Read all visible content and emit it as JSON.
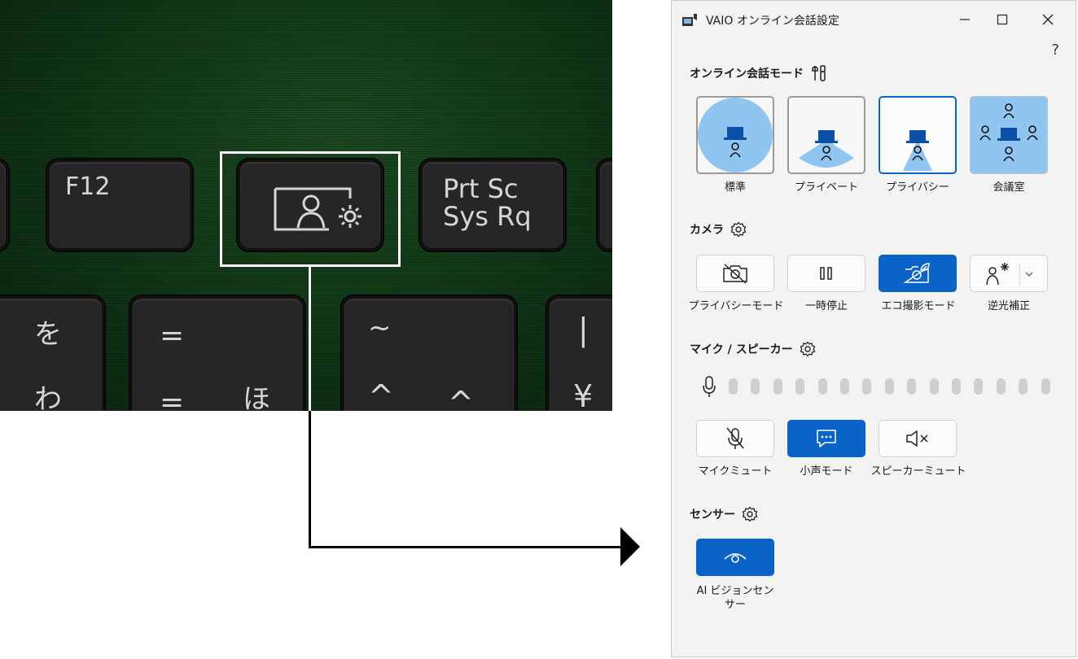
{
  "keyboard": {
    "keys": {
      "f12": "F12",
      "prtsc": "Prt Sc\nSys Rq",
      "wo": "を",
      "wa": "わ",
      "equals": "=",
      "minus": "=",
      "ho": "ほ",
      "tilde": "~",
      "caret": "^",
      "hat": "^",
      "pipe": "|",
      "yen": "¥"
    }
  },
  "window": {
    "title": "VAIO オンライン会話設定",
    "help": "?",
    "controls": {
      "minimize": "—",
      "maximize": "☐",
      "close": "✕"
    }
  },
  "sections": {
    "mode": {
      "title": "オンライン会話モード",
      "items": [
        {
          "label": "標準",
          "state": "outlined-gray"
        },
        {
          "label": "プライベート",
          "state": "outlined-gray"
        },
        {
          "label": "プライバシー",
          "state": "selected"
        },
        {
          "label": "会議室",
          "state": "filled-light"
        }
      ]
    },
    "camera": {
      "title": "カメラ",
      "items": [
        {
          "label": "プライバシーモード",
          "icon": "camera-off-icon",
          "active": false
        },
        {
          "label": "一時停止",
          "icon": "pause-icon",
          "active": false
        },
        {
          "label": "エコ撮影モード",
          "icon": "eco-camera-icon",
          "active": true
        },
        {
          "label": "逆光補正",
          "icon": "backlight-icon",
          "active": false
        }
      ]
    },
    "mic": {
      "title": "マイク / スピーカー",
      "items": [
        {
          "label": "マイクミュート",
          "icon": "mic-off-icon",
          "active": false
        },
        {
          "label": "小声モード",
          "icon": "chat-icon",
          "active": true
        },
        {
          "label": "スピーカーミュート",
          "icon": "speaker-mute-icon",
          "active": false
        }
      ]
    },
    "sensor": {
      "title": "センサー",
      "items": [
        {
          "label": "AI ビジョンセン\nサー",
          "icon": "eye-icon",
          "active": true
        }
      ]
    }
  },
  "colors": {
    "accent": "#0a64c8",
    "light_blue": "#8fc5f0",
    "window_bg": "#f3f3f3"
  }
}
